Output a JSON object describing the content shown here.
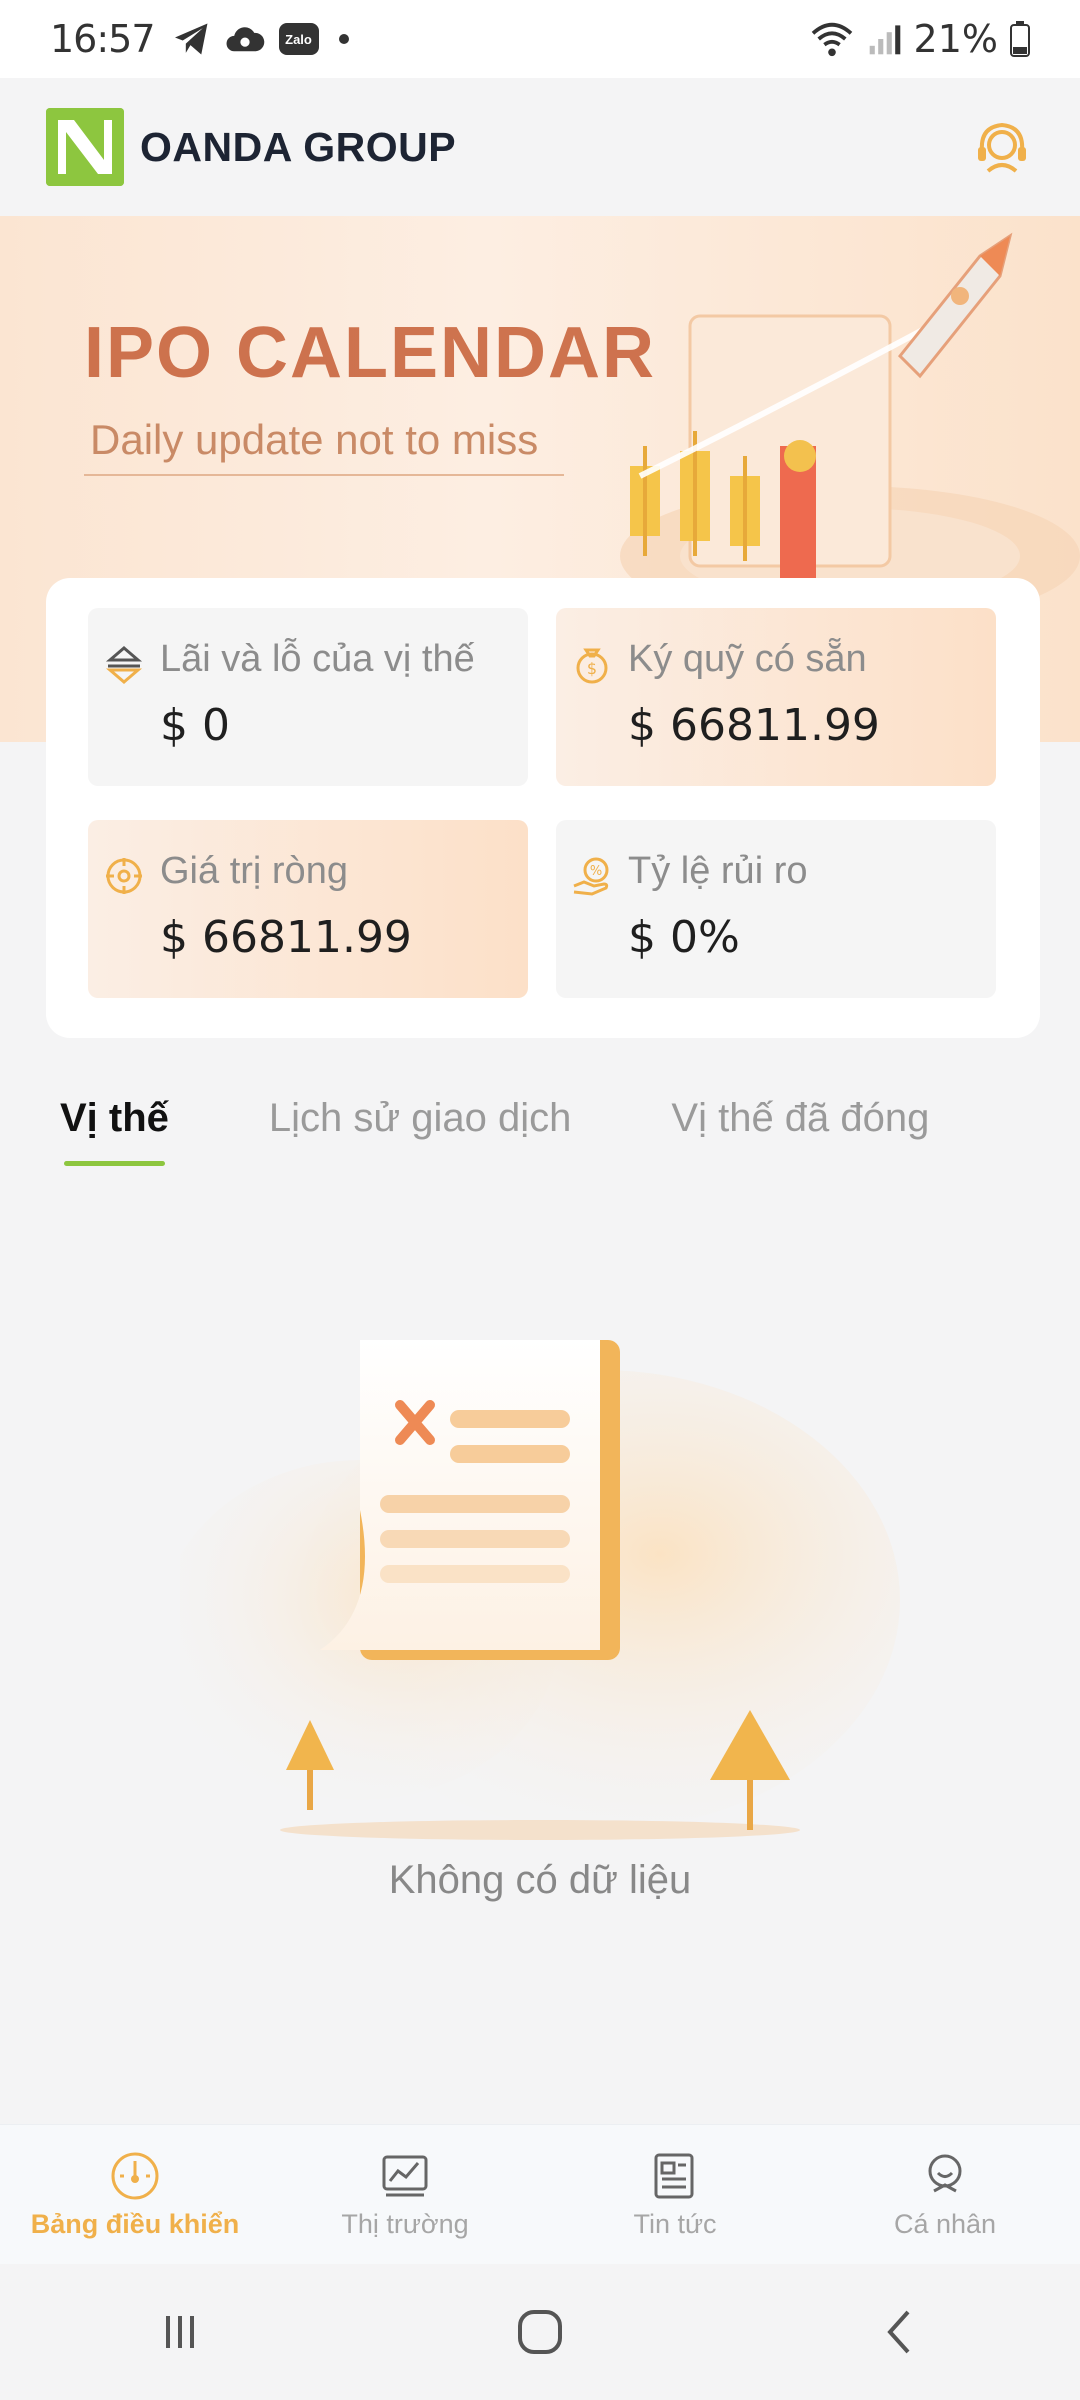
{
  "status_bar": {
    "time": "16:57",
    "battery": "21%",
    "notification_icons": [
      "telegram-icon",
      "cloud-icon",
      "zalo-icon",
      "dot-icon"
    ],
    "zalo_label": "Zalo"
  },
  "header": {
    "brand": "OANDA GROUP",
    "logo_color": "#8dc63f",
    "support_icon": "customer-service-icon",
    "accent": "#f0b04a"
  },
  "banner": {
    "title": "IPO CALENDAR",
    "subtitle": "Daily update not to miss"
  },
  "stats": [
    {
      "label": "Lãi và lỗ của vị thế",
      "value": "$ 0",
      "icon": "arrows-updown-icon"
    },
    {
      "label": "Ký quỹ có sẵn",
      "value": "$ 66811.99",
      "icon": "money-bag-icon"
    },
    {
      "label": "Giá trị ròng",
      "value": "$ 66811.99",
      "icon": "target-icon"
    },
    {
      "label": "Tỷ lệ rủi ro",
      "value": "$ 0%",
      "icon": "hand-percent-icon"
    }
  ],
  "tabs": [
    {
      "label": "Vị thế",
      "active": true
    },
    {
      "label": "Lịch sử giao dịch",
      "active": false
    },
    {
      "label": "Vị thế đã đóng",
      "active": false
    }
  ],
  "empty_state": {
    "message": "Không có dữ liệu"
  },
  "bottom_nav": [
    {
      "label": "Bảng điều khiển",
      "icon": "dashboard-gauge-icon",
      "active": true
    },
    {
      "label": "Thị trường",
      "icon": "market-chart-icon",
      "active": false
    },
    {
      "label": "Tin tức",
      "icon": "news-icon",
      "active": false
    },
    {
      "label": "Cá nhân",
      "icon": "profile-icon",
      "active": false
    }
  ]
}
